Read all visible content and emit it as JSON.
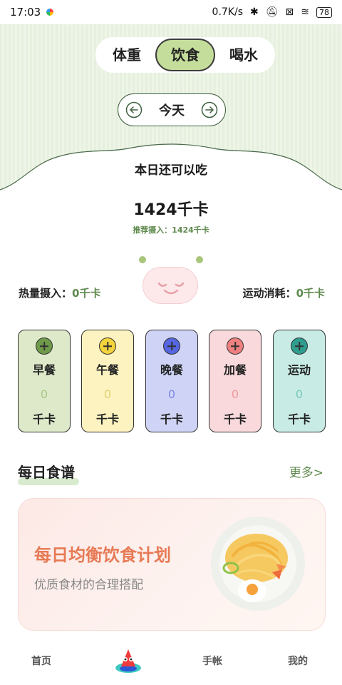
{
  "status": {
    "time": "17:03",
    "speed": "0.7K/s",
    "battery": "78"
  },
  "tabs": [
    {
      "label": "体重"
    },
    {
      "label": "饮食"
    },
    {
      "label": "喝水"
    }
  ],
  "date": {
    "label": "今天"
  },
  "summary": {
    "remaining_label": "本日还可以吃",
    "remaining_value": "1424千卡",
    "recommended": "推荐摄入：1424千卡",
    "intake_label": "热量摄入：",
    "intake_value": "0千卡",
    "burn_label": "运动消耗：",
    "burn_value": "0千卡"
  },
  "meals": [
    {
      "name": "早餐",
      "value": "0",
      "unit": "千卡",
      "bg": "#dde9c9",
      "accent": "#6f9a4a",
      "val_color": "#a9c783"
    },
    {
      "name": "午餐",
      "value": "0",
      "unit": "千卡",
      "bg": "#fcf3c0",
      "accent": "#f2d33c",
      "val_color": "#e3cf72"
    },
    {
      "name": "晚餐",
      "value": "0",
      "unit": "千卡",
      "bg": "#cfd4f6",
      "accent": "#5566e0",
      "val_color": "#7d89e6"
    },
    {
      "name": "加餐",
      "value": "0",
      "unit": "千卡",
      "bg": "#f9d9dc",
      "accent": "#ef8080",
      "val_color": "#ee9b9b"
    },
    {
      "name": "运动",
      "value": "0",
      "unit": "千卡",
      "bg": "#c8ece5",
      "accent": "#2f9e8f",
      "val_color": "#76c8bb"
    }
  ],
  "recipes": {
    "title": "每日食谱",
    "more": "更多>",
    "plan_title": "每日均衡饮食计划",
    "plan_subtitle": "优质食材的合理搭配"
  },
  "nav": [
    {
      "label": "首页"
    },
    {
      "label": "手帐"
    },
    {
      "label": "我的"
    }
  ]
}
